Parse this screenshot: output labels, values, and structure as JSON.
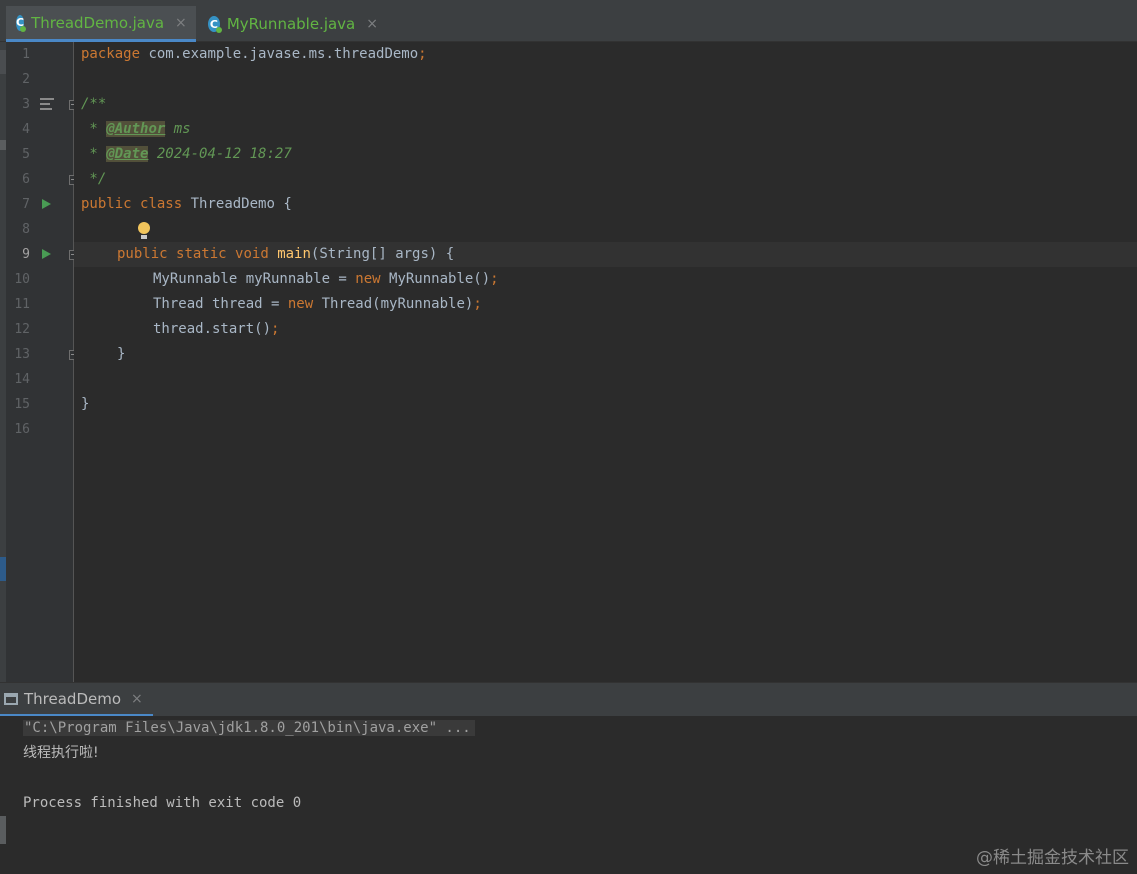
{
  "tabs": [
    {
      "label": "ThreadDemo.java",
      "icon": "class-icon",
      "active": true
    },
    {
      "label": "MyRunnable.java",
      "icon": "class-icon",
      "active": false
    }
  ],
  "close_glyph": "×",
  "class_icon_letter": "C",
  "gutter": {
    "line_numbers": [
      "1",
      "2",
      "3",
      "4",
      "5",
      "6",
      "7",
      "8",
      "9",
      "10",
      "11",
      "12",
      "13",
      "14",
      "15",
      "16"
    ],
    "current_line": "9"
  },
  "code": {
    "line1": {
      "kw": "package",
      "rest": " com.example.javase.ms.threadDemo",
      "semi": ";"
    },
    "line3": "/**",
    "line4": {
      "star": " * ",
      "tag": "@Author",
      "text": " ms"
    },
    "line5": {
      "star": " * ",
      "tag": "@Date",
      "text": " 2024-04-12 18:27"
    },
    "line6": " */",
    "line7": {
      "kw1": "public",
      "kw2": "class",
      "rest": " ThreadDemo {"
    },
    "line9": {
      "kw1": "public",
      "kw2": "static",
      "kw3": "void",
      "fn": "main",
      "rest": "(String[] args) {"
    },
    "line10": {
      "a": "MyRunnable myRunnable = ",
      "kw": "new",
      "b": " MyRunnable()",
      "semi": ";"
    },
    "line11": {
      "a": "Thread thread = ",
      "kw": "new",
      "b": " Thread(myRunnable)",
      "semi": ";"
    },
    "line12": {
      "a": "thread.start()",
      "semi": ";"
    },
    "line13": "}",
    "line15": "}"
  },
  "run_panel": {
    "tab_label": "ThreadDemo",
    "console": {
      "command": "\"C:\\Program Files\\Java\\jdk1.8.0_201\\bin\\java.exe\" ...",
      "output": "线程执行啦!",
      "exit": "Process finished with exit code 0"
    }
  },
  "watermark": "@稀土掘金技术社区",
  "colors": {
    "keyword": "#cc7832",
    "function": "#ffc66d",
    "doc_comment": "#629755",
    "tab_label": "#62b543",
    "accent": "#4a88c7"
  }
}
